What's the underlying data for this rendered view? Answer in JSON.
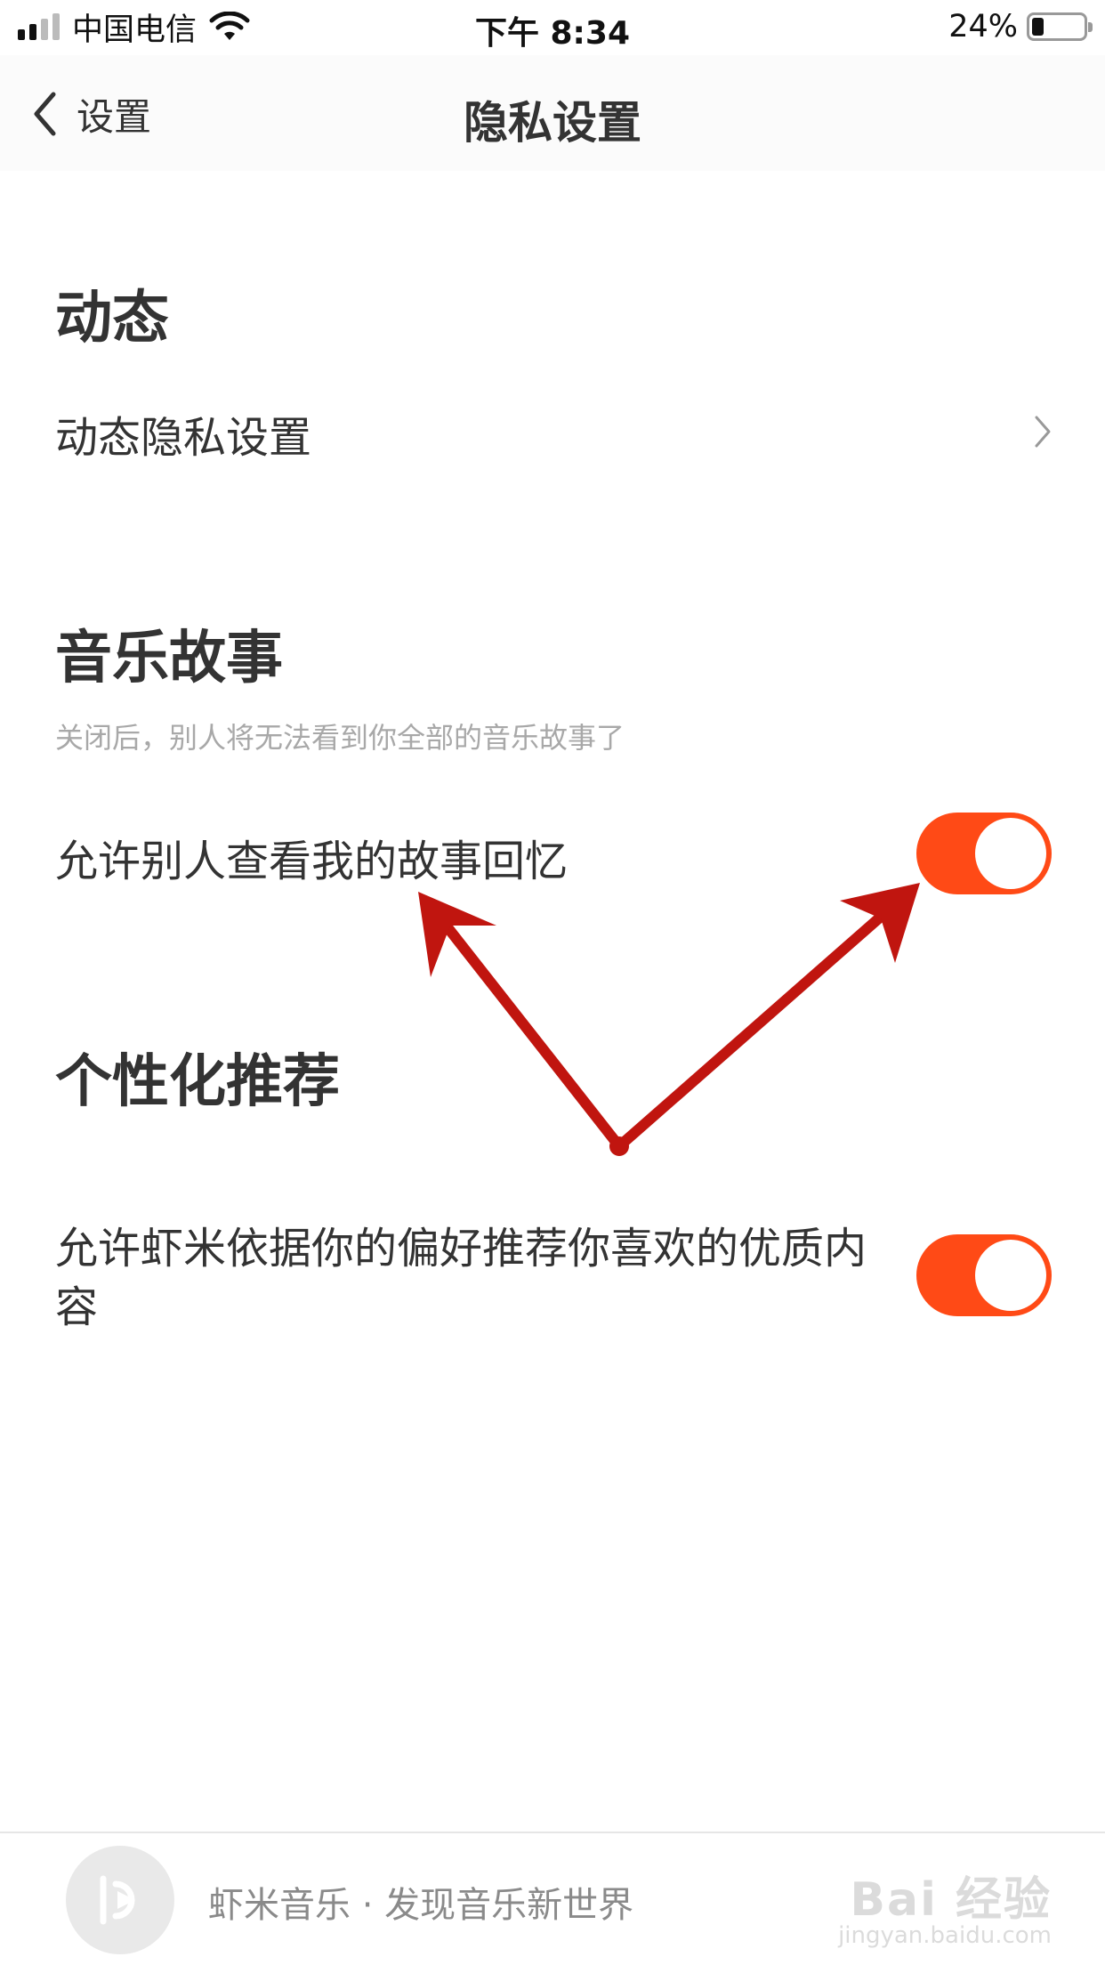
{
  "status_bar": {
    "carrier": "中国电信",
    "time": "下午 8:34",
    "battery": "24%",
    "battery_level": 0.24,
    "signal_icon": "signal-icon",
    "wifi_icon": "wifi-icon"
  },
  "nav": {
    "back_label": "设置",
    "title": "隐私设置",
    "back_icon": "chevron-left-icon"
  },
  "sections": {
    "dynamic": {
      "title": "动态",
      "row_label": "动态隐私设置",
      "row_icon": "chevron-right-icon"
    },
    "music_story": {
      "title": "音乐故事",
      "hint": "关闭后，别人将无法看到你全部的音乐故事了",
      "toggle_label": "允许别人查看我的故事回忆",
      "toggle_on": true
    },
    "recommend": {
      "title": "个性化推荐",
      "toggle_label": "允许虾米依据你的偏好推荐你喜欢的优质内容",
      "toggle_on": true
    }
  },
  "player": {
    "text": "虾米音乐 · 发现音乐新世界",
    "cover_icon": "xiami-logo-icon"
  },
  "watermark": {
    "main": "Bai 经验",
    "sub": "jingyan.baidu.com"
  },
  "colors": {
    "accent": "#ff4a16",
    "annotation": "#c0150f",
    "text": "#333333",
    "hint": "#a8a8a8"
  }
}
